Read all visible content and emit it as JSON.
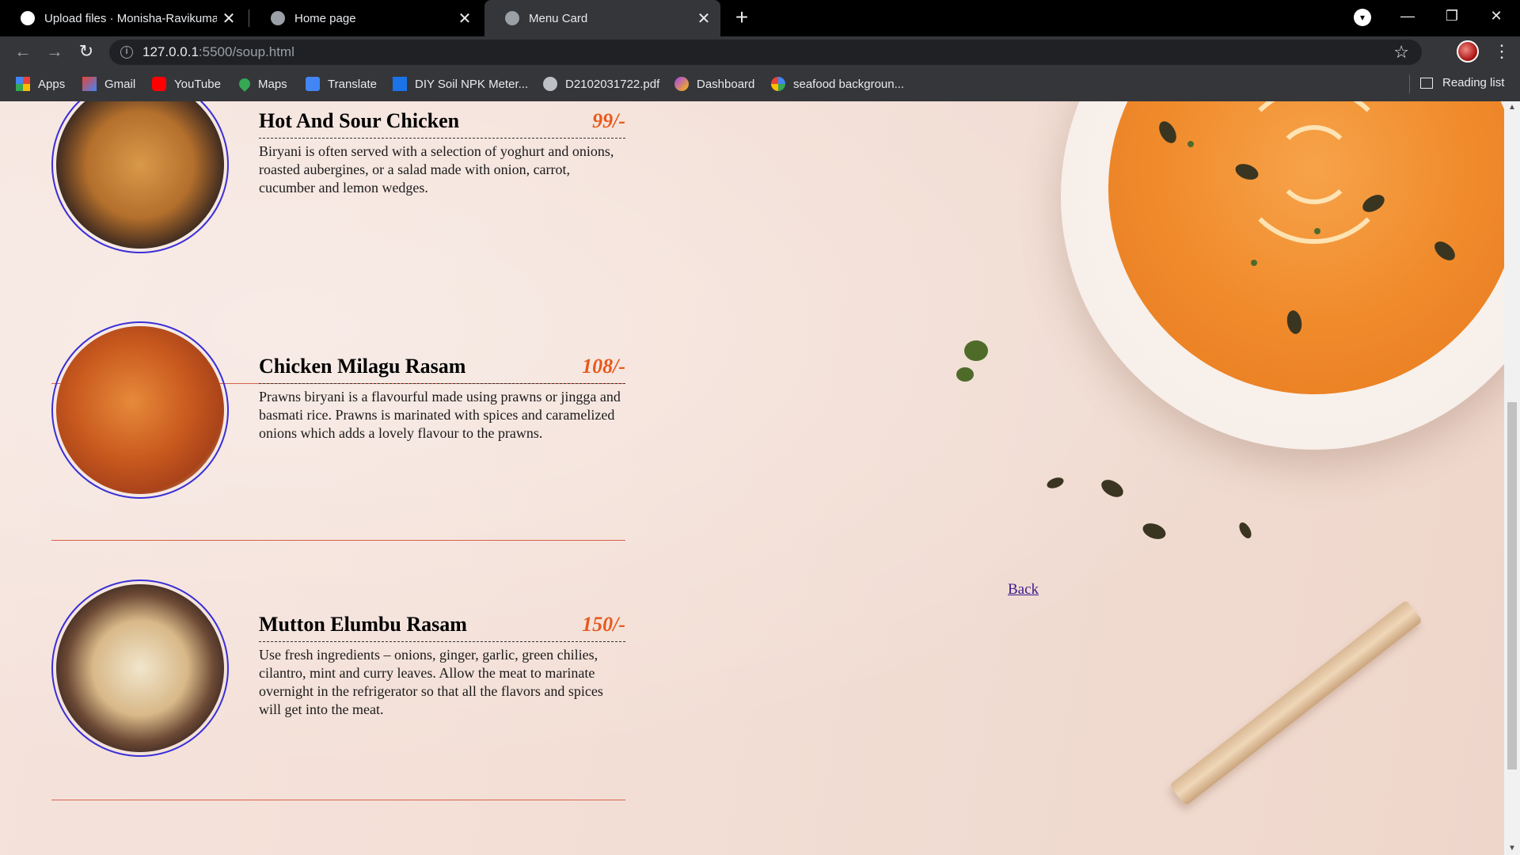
{
  "browser": {
    "tabs": [
      {
        "title": "Upload files · Monisha-Ravikuma",
        "active": false
      },
      {
        "title": "Home page",
        "active": false
      },
      {
        "title": "Menu Card",
        "active": true
      }
    ],
    "url_host": "127.0.0.1",
    "url_path": ":5500/soup.html",
    "bookmarks": [
      {
        "label": "Apps",
        "icon": "apps-grid-icon"
      },
      {
        "label": "Gmail",
        "icon": "gmail-icon"
      },
      {
        "label": "YouTube",
        "icon": "youtube-icon"
      },
      {
        "label": "Maps",
        "icon": "maps-icon"
      },
      {
        "label": "Translate",
        "icon": "translate-icon"
      },
      {
        "label": "DIY Soil NPK Meter...",
        "icon": "page-icon"
      },
      {
        "label": "D2102031722.pdf",
        "icon": "globe-icon"
      },
      {
        "label": "Dashboard",
        "icon": "dashboard-icon"
      },
      {
        "label": "seafood backgroun...",
        "icon": "google-icon"
      }
    ],
    "reading_list": "Reading list"
  },
  "menu": {
    "items": [
      {
        "name": "Hot And Sour Chicken",
        "price": "99/-",
        "description": "Biryani is often served with a selection of yoghurt and onions, roasted aubergines, or a salad made with onion, carrot, cucumber and lemon wedges."
      },
      {
        "name": "Chicken Milagu Rasam",
        "price": "108/-",
        "description": "Prawns biryani is a flavourful made using prawns or jingga and basmati rice. Prawns is marinated with spices and caramelized onions which adds a lovely flavour to the prawns."
      },
      {
        "name": "Mutton Elumbu Rasam",
        "price": "150/-",
        "description": "Use fresh ingredients – onions, ginger, garlic, green chilies, cilantro, mint and curry leaves. Allow the meat to marinate overnight in the refrigerator so that all the flavors and spices will get into the meat."
      }
    ],
    "back_link": "Back"
  },
  "colors": {
    "price": "#e8591c",
    "divider": "#d9604a",
    "plate_border": "#3a2fd6",
    "link": "#3b1a8a"
  }
}
